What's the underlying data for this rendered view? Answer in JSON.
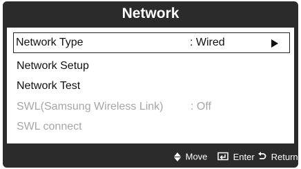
{
  "title": "Network",
  "menu": {
    "items": [
      {
        "label": "Network Type",
        "value": ": Wired",
        "selected": true,
        "enabled": true
      },
      {
        "label": "Network Setup",
        "value": "",
        "selected": false,
        "enabled": true
      },
      {
        "label": "Network Test",
        "value": "",
        "selected": false,
        "enabled": true
      },
      {
        "label": "SWL(Samsung Wireless Link)",
        "value": ": Off",
        "selected": false,
        "enabled": false
      },
      {
        "label": "SWL connect",
        "value": "",
        "selected": false,
        "enabled": false
      }
    ]
  },
  "footer": {
    "move_label": "Move",
    "enter_label": "Enter",
    "return_label": "Return",
    "move_icon": "up-down-arrows-icon",
    "enter_icon": "enter-icon",
    "return_icon": "return-icon"
  },
  "colors": {
    "osd_background": "#2b2b2b",
    "panel_background": "#ffffff",
    "text_enabled": "#111111",
    "text_disabled": "#a6a6a6"
  }
}
